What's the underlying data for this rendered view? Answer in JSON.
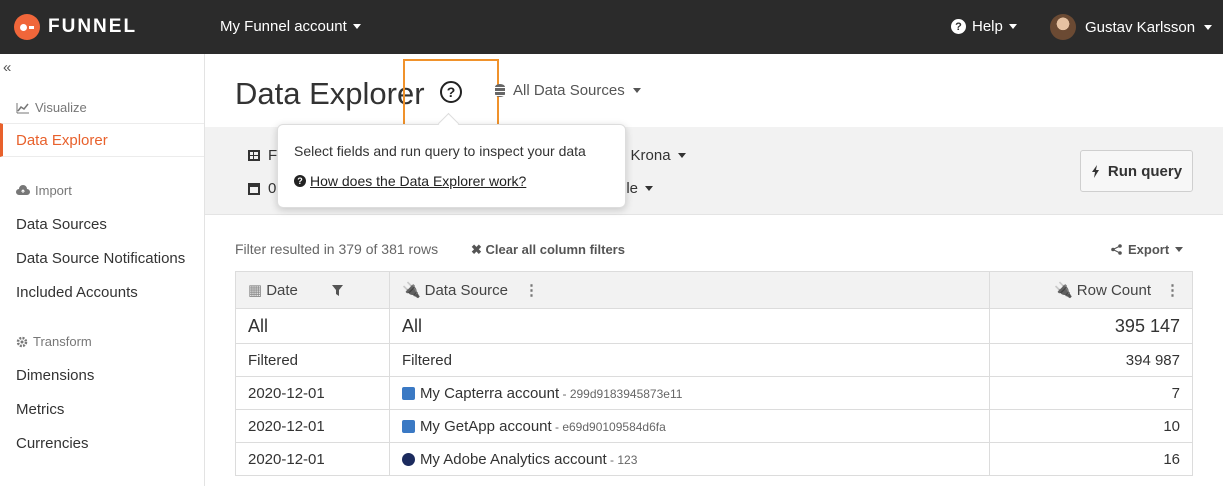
{
  "topbar": {
    "brand": "FUNNEL",
    "account_label": "My Funnel account",
    "help_label": "Help",
    "user_name": "Gustav Karlsson"
  },
  "sidebar": {
    "collapse_glyph": "«",
    "sections": {
      "visualize": "Visualize",
      "import": "Import",
      "transform": "Transform"
    },
    "items": [
      {
        "label": "Data Explorer",
        "active": true
      },
      {
        "label": "Data Sources"
      },
      {
        "label": "Data Source Notifications"
      },
      {
        "label": "Included Accounts"
      },
      {
        "label": "Dimensions"
      },
      {
        "label": "Metrics"
      },
      {
        "label": "Currencies"
      }
    ]
  },
  "main": {
    "title": "Data Explorer",
    "datasource_selector": "All Data Sources",
    "query": {
      "fields_prefix": "F",
      "date_prefix": "0",
      "currency_suffix": "n Krona",
      "comparison_suffix": "ble",
      "run_label": "Run query"
    },
    "popover": {
      "text": "Select fields and run query to inspect your data",
      "link": "How does the Data Explorer work?"
    },
    "filter_info": "Filter resulted in 379 of 381 rows",
    "clear_filters": "Clear all column filters",
    "export_label": "Export"
  },
  "table": {
    "columns": [
      "Date",
      "Data Source",
      "Row Count"
    ],
    "all": {
      "date": "All",
      "source": "All",
      "count": "395 147"
    },
    "filtered": {
      "date": "Filtered",
      "source": "Filtered",
      "count": "394 987"
    },
    "rows": [
      {
        "date": "2020-12-01",
        "source": "My Capterra account",
        "id": " - 299d9183945873e11",
        "count": "7",
        "icon": "capterra-icon"
      },
      {
        "date": "2020-12-01",
        "source": "My GetApp account",
        "id": " - e69d90109584d6fa",
        "count": "10",
        "icon": "getapp-icon"
      },
      {
        "date": "2020-12-01",
        "source": "My Adobe Analytics account",
        "id": " - 123",
        "count": "16",
        "icon": "adobe-analytics-icon"
      }
    ]
  },
  "colors": {
    "accent": "#e8612c",
    "topbar": "#2b2b2b",
    "highlight": "#f0922b"
  }
}
